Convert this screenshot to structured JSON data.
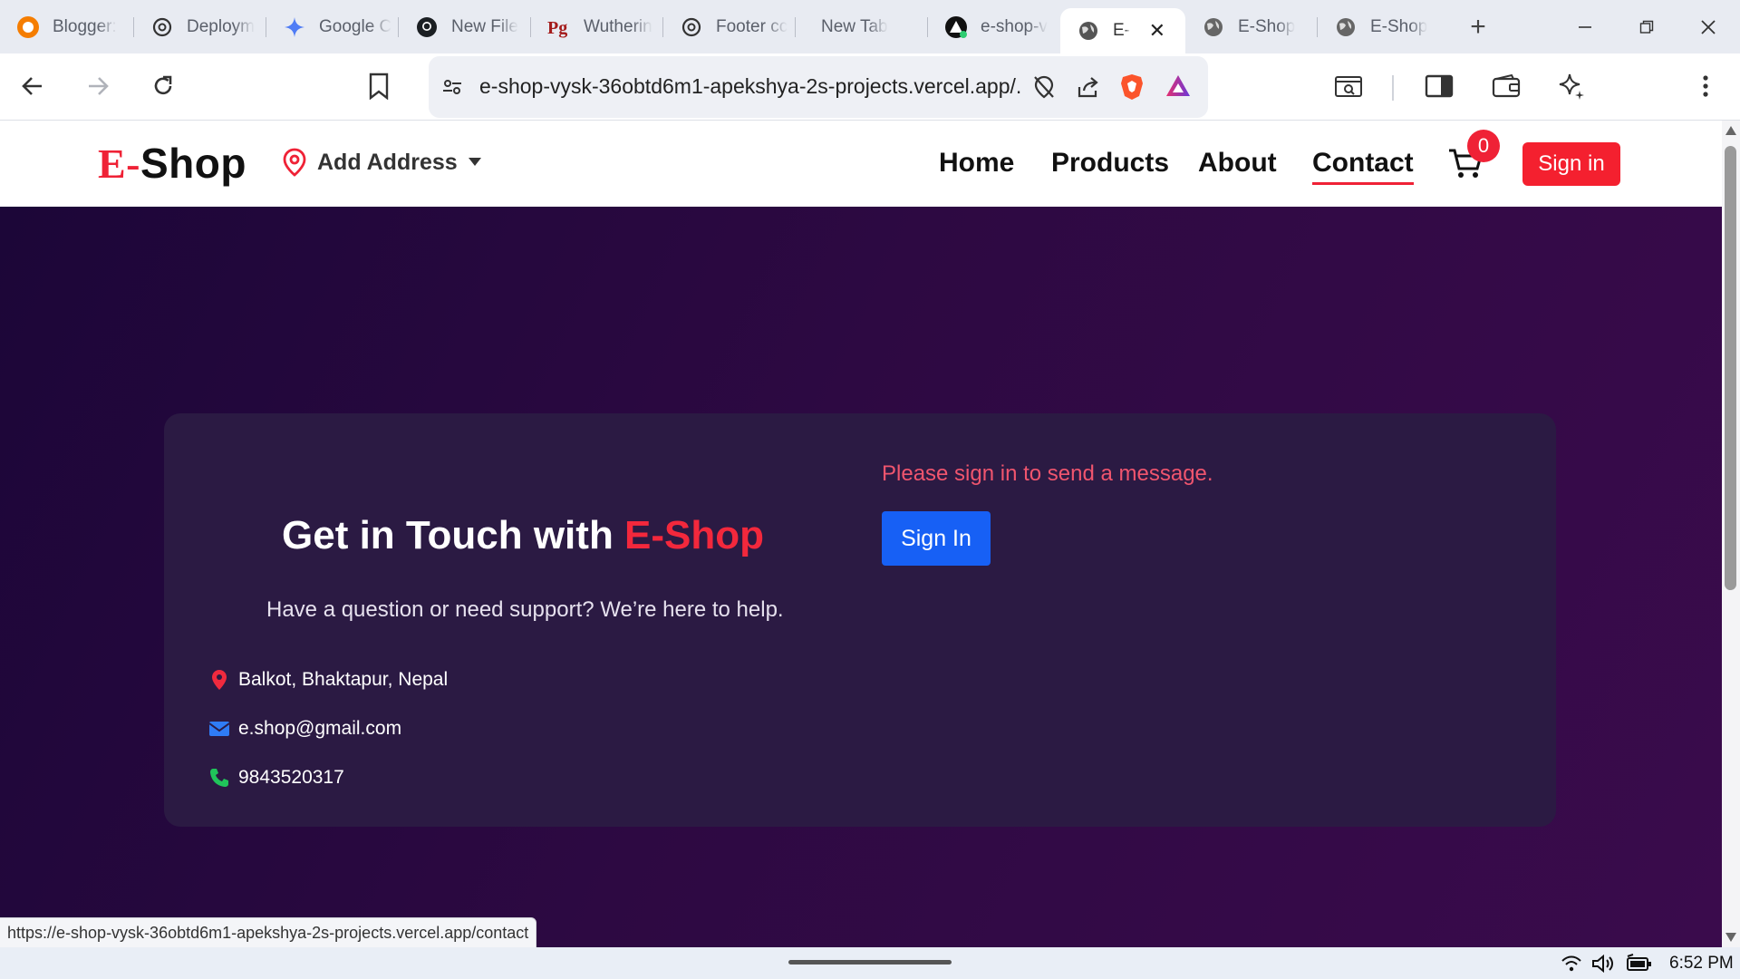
{
  "browser": {
    "tabs": [
      {
        "label": "Blogger:",
        "icon": "blogger-icon"
      },
      {
        "label": "Deploym",
        "icon": "openai-icon"
      },
      {
        "label": "Google C",
        "icon": "gemini-icon"
      },
      {
        "label": "New File",
        "icon": "github-icon"
      },
      {
        "label": "Wutherin",
        "icon": "pg-icon"
      },
      {
        "label": "Footer cc",
        "icon": "openai-icon"
      },
      {
        "label": "New Tab",
        "icon": ""
      },
      {
        "label": "e-shop-v",
        "icon": "vercel-icon"
      },
      {
        "label": "E-",
        "icon": "globe-icon",
        "active": true
      },
      {
        "label": "E-Shop",
        "icon": "globe-icon"
      },
      {
        "label": "E-Shop",
        "icon": "globe-icon"
      }
    ],
    "url": "e-shop-vysk-36obtd6m1-apekshya-2s-projects.vercel.app/...",
    "status_url": "https://e-shop-vysk-36obtd6m1-apekshya-2s-projects.vercel.app/contact",
    "clock": "6:52 PM"
  },
  "header": {
    "logo_e": "E-",
    "logo_rest": "Shop",
    "address": "Add Address",
    "nav": [
      "Home",
      "Products",
      "About",
      "Contact"
    ],
    "active_nav": "Contact",
    "cart_count": "0",
    "signin": "Sign in"
  },
  "contact": {
    "title_prefix": "Get in Touch with ",
    "title_brand": "E-Shop",
    "subtitle": "Have a question or need support? We’re here to help.",
    "address": "Balkot, Bhaktapur, Nepal",
    "email": "e.shop@gmail.com",
    "phone": "9843520317",
    "warning": "Please sign in to send a message.",
    "signin_button": "Sign In"
  },
  "colors": {
    "brand_red": "#ef2236",
    "primary_blue": "#1760f5",
    "hero_bg": "#2d0942",
    "card_bg": "#2b1a43"
  }
}
